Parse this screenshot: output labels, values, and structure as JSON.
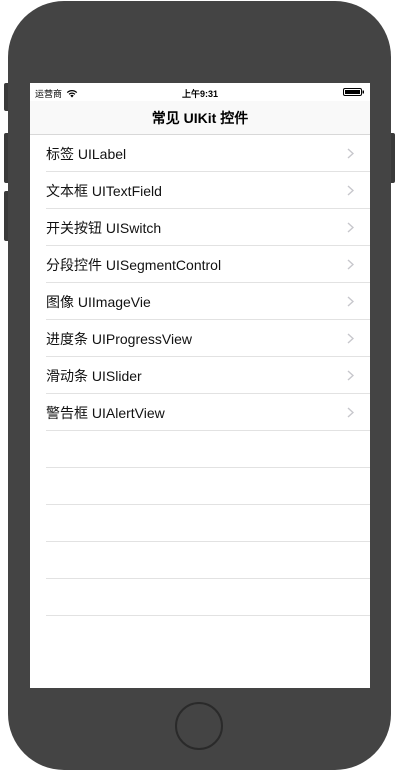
{
  "status_bar": {
    "carrier": "运营商",
    "wifi_icon": "wifi-icon",
    "time": "上午9:31",
    "battery_icon": "battery-icon"
  },
  "nav": {
    "title": "常见 UIKit 控件"
  },
  "list": {
    "items": [
      {
        "label": "标签 UILabel"
      },
      {
        "label": "文本框  UITextField"
      },
      {
        "label": "开关按钮 UISwitch"
      },
      {
        "label": "分段控件 UISegmentControl"
      },
      {
        "label": "图像 UIImageVie"
      },
      {
        "label": "进度条 UIProgressView"
      },
      {
        "label": "滑动条 UISlider"
      },
      {
        "label": "警告框 UIAlertView"
      }
    ],
    "chevron_icon": "chevron-right-icon"
  },
  "colors": {
    "device_frame": "#444444",
    "separator": "#e2e2e2",
    "chevron": "#c7c7cc"
  }
}
